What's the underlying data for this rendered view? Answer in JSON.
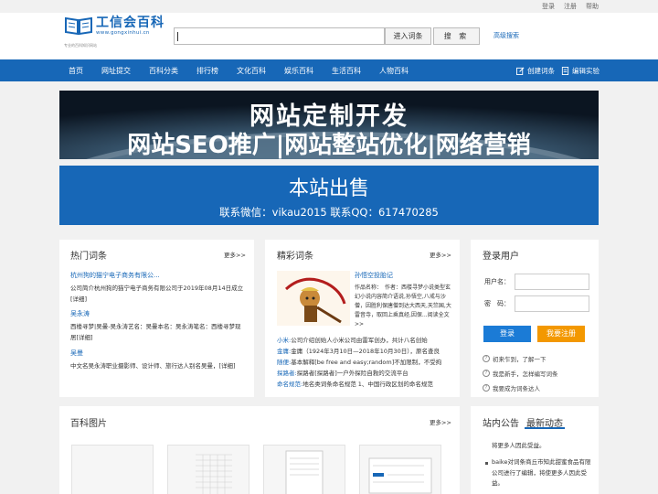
{
  "toplinks": [
    "登录",
    "注册",
    "帮助"
  ],
  "logo": {
    "title": "工信会百科",
    "url": "www.gongxinhui.cn",
    "tagline": "专业的百科知识网站"
  },
  "search": {
    "value": "",
    "btn_entry": "进入词条",
    "btn_search": "搜 索",
    "advanced": "高级搜索"
  },
  "nav": {
    "items": [
      "首页",
      "网址提交",
      "百科分类",
      "排行榜",
      "文化百科",
      "娱乐百科",
      "生活百科",
      "人物百科"
    ],
    "create": "创建词条",
    "edit": "编辑实验"
  },
  "banner1": {
    "line1": "网站定制开发",
    "line2": "网站SEO推广|网站整站优化|网络营销"
  },
  "banner2": {
    "line1": "本站出售",
    "line2": "联系微信：vikau2015 联系QQ：617470285"
  },
  "hot": {
    "title": "热门词条",
    "more": "更多>>",
    "items": [
      {
        "title": "杭州狗的猫宁电子商务有限公...",
        "desc": "公司简介杭州狗的猫宁电子商务有限公司于2019年08月14日成立[详细]"
      },
      {
        "title": "吴永涛",
        "desc": "西楼寻梦|吴曼-吴永涛艺名：吴曼本名：吴永涛笔名：西楼寻梦现居[详细]"
      },
      {
        "title": "吴曼",
        "desc": "中文名吴永涛职业摄影师、设计师、旅行达人别名吴曼，[详细]"
      }
    ]
  },
  "featured": {
    "title": "精彩词条",
    "more": "更多>>",
    "headline": "孙悟空投胎记",
    "headline_desc": "作品名称：　作者：西楼寻梦小说类型玄幻小说内容简介语说,孙悟空,八戒与沙僧，因胜利保唐僧到达大西天,天竺国,大雷音寺，取回上乘真经,因保...阅读全文>>",
    "list": [
      {
        "k": "小米:",
        "v": "公司介绍创始人小米公司由雷军创办，共计八名创始"
      },
      {
        "k": "金庸:",
        "v": "金庸（1924年3月10日—2018年10月30日），原名查良"
      },
      {
        "k": "随便:",
        "v": "基本解释[be free and easy;random]不加限制，不受拘"
      },
      {
        "k": "探路者:",
        "v": "探路者[探路者]一户外探险自救的交流平台"
      },
      {
        "k": "命名规范:",
        "v": "地名类词条命名规范 1、中国行政区划的命名规范"
      }
    ]
  },
  "login": {
    "title": "登录用户",
    "username_label": "用户名：",
    "password_label": "密　码：",
    "login_btn": "登录",
    "register_btn": "我要注册",
    "links": [
      "初来乍到，了解一下",
      "我是新手，怎样编写词条",
      "我要成为词条达人"
    ]
  },
  "pics": {
    "title": "百科图片",
    "more": "更多>>"
  },
  "notice": {
    "tab1": "站内公告",
    "tab2": "最新动态",
    "items": [
      "将更多人因此受益。",
      "baike对词条商丘市知此甜蜜食品有限公司进行了编辑，将使更多人因此受益。"
    ]
  },
  "colors": {
    "brand": "#1767b7",
    "login_btn": "#1b7bd6",
    "register_btn": "#f39800"
  }
}
